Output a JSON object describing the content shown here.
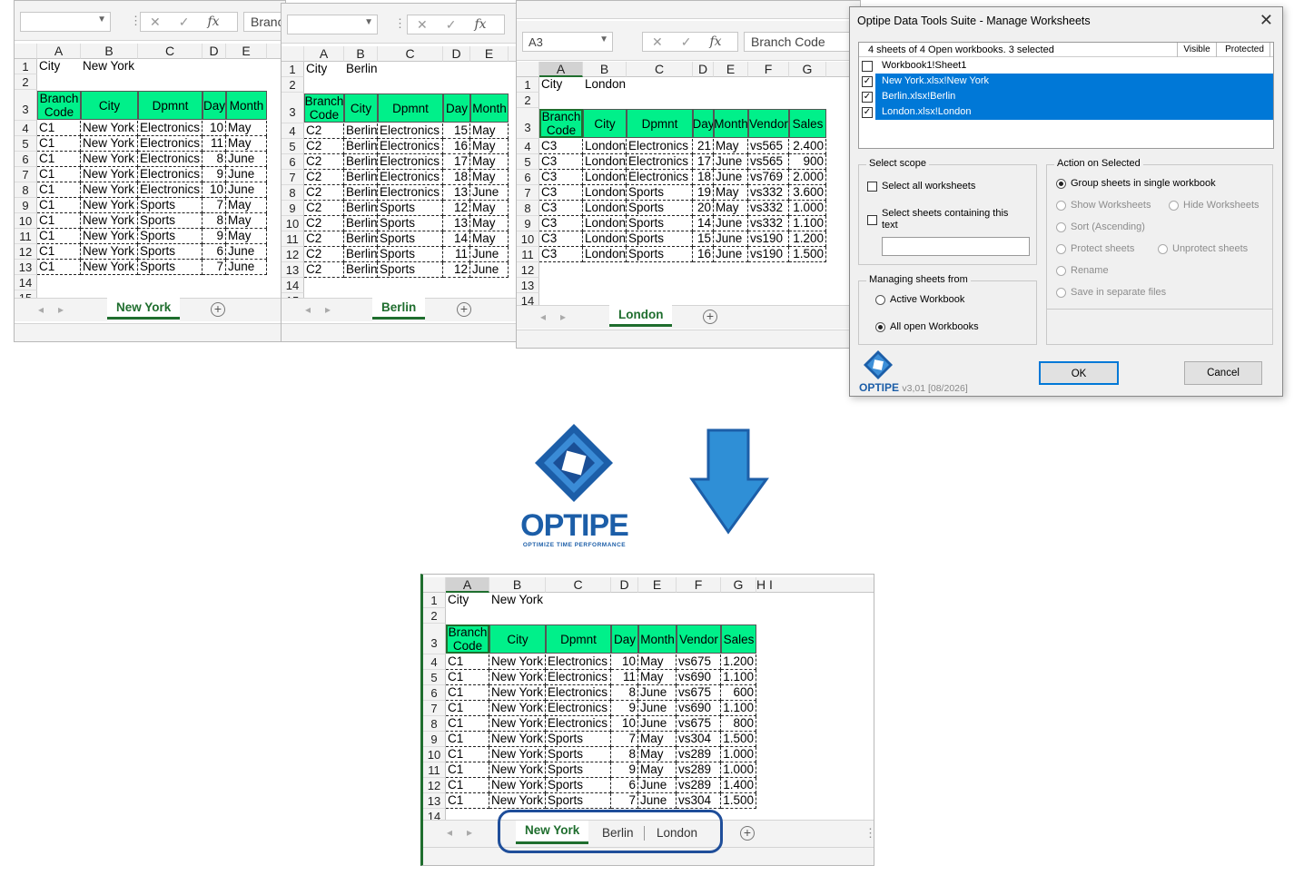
{
  "cols_short": [
    "A",
    "B",
    "C",
    "D",
    "E"
  ],
  "cols_full": [
    "A",
    "B",
    "C",
    "D",
    "E",
    "F",
    "G"
  ],
  "cols_bottom": [
    "A",
    "B",
    "C",
    "D",
    "E",
    "F",
    "G",
    "H",
    "I"
  ],
  "rows_label": [
    "1",
    "2",
    "3",
    "4",
    "5",
    "6",
    "7",
    "8",
    "9",
    "10",
    "11",
    "12",
    "13",
    "14",
    "15"
  ],
  "headers": [
    "Branch Code",
    "City",
    "Dpmnt",
    "Day",
    "Month",
    "Vendor",
    "Sales"
  ],
  "ny": {
    "namebox": "",
    "formula": "Branch Code",
    "city_label": "City",
    "city_value": "New York",
    "tab": "New York",
    "rows": [
      [
        "C1",
        "New York",
        "Electronics",
        "10",
        "May",
        "vs675",
        "1.200"
      ],
      [
        "C1",
        "New York",
        "Electronics",
        "11",
        "May",
        "vs690",
        "1.100"
      ],
      [
        "C1",
        "New York",
        "Electronics",
        "8",
        "June",
        "vs675",
        "600"
      ],
      [
        "C1",
        "New York",
        "Electronics",
        "9",
        "June",
        "vs690",
        "1.100"
      ],
      [
        "C1",
        "New York",
        "Electronics",
        "10",
        "June",
        "vs675",
        "800"
      ],
      [
        "C1",
        "New York",
        "Sports",
        "7",
        "May",
        "vs304",
        "1.500"
      ],
      [
        "C1",
        "New York",
        "Sports",
        "8",
        "May",
        "vs289",
        "1.000"
      ],
      [
        "C1",
        "New York",
        "Sports",
        "9",
        "May",
        "vs289",
        "1.000"
      ],
      [
        "C1",
        "New York",
        "Sports",
        "6",
        "June",
        "vs289",
        "1.400"
      ],
      [
        "C1",
        "New York",
        "Sports",
        "7",
        "June",
        "vs304",
        "1.500"
      ]
    ]
  },
  "berlin": {
    "namebox": "",
    "formula": "Branch Code",
    "city_label": "City",
    "city_value": "Berlin",
    "tab": "Berlin",
    "rows": [
      [
        "C2",
        "Berlin",
        "Electronics",
        "15",
        "May"
      ],
      [
        "C2",
        "Berlin",
        "Electronics",
        "16",
        "May"
      ],
      [
        "C2",
        "Berlin",
        "Electronics",
        "17",
        "May"
      ],
      [
        "C2",
        "Berlin",
        "Electronics",
        "18",
        "May"
      ],
      [
        "C2",
        "Berlin",
        "Electronics",
        "13",
        "June"
      ],
      [
        "C2",
        "Berlin",
        "Sports",
        "12",
        "May"
      ],
      [
        "C2",
        "Berlin",
        "Sports",
        "13",
        "May"
      ],
      [
        "C2",
        "Berlin",
        "Sports",
        "14",
        "May"
      ],
      [
        "C2",
        "Berlin",
        "Sports",
        "11",
        "June"
      ],
      [
        "C2",
        "Berlin",
        "Sports",
        "12",
        "June"
      ]
    ]
  },
  "london": {
    "namebox": "A3",
    "formula": "Branch Code",
    "city_label": "City",
    "city_value": "London",
    "tab": "London",
    "rows": [
      [
        "C3",
        "London",
        "Electronics",
        "21",
        "May",
        "vs565",
        "2.400"
      ],
      [
        "C3",
        "London",
        "Electronics",
        "17",
        "June",
        "vs565",
        "900"
      ],
      [
        "C3",
        "London",
        "Electronics",
        "18",
        "June",
        "vs769",
        "2.000"
      ],
      [
        "C3",
        "London",
        "Sports",
        "19",
        "May",
        "vs332",
        "3.600"
      ],
      [
        "C3",
        "London",
        "Sports",
        "20",
        "May",
        "vs332",
        "1.000"
      ],
      [
        "C3",
        "London",
        "Sports",
        "14",
        "June",
        "vs332",
        "1.100"
      ],
      [
        "C3",
        "London",
        "Sports",
        "15",
        "June",
        "vs190",
        "1.200"
      ],
      [
        "C3",
        "London",
        "Sports",
        "16",
        "June",
        "vs190",
        "1.500"
      ]
    ]
  },
  "result": {
    "tabs": [
      "New York",
      "Berlin",
      "London"
    ],
    "highlight_color": "#1f4e9a"
  },
  "dialog": {
    "title": "Optipe Data Tools Suite - Manage Worksheets",
    "list_header": "4 sheets of 4 Open workbooks.  3 selected",
    "col_visible": "Visible",
    "col_protected": "Protected",
    "items": [
      {
        "label": "Workbook1!Sheet1",
        "checked": false
      },
      {
        "label": "New York.xlsx!New York",
        "checked": true
      },
      {
        "label": "Berlin.xlsx!Berlin",
        "checked": true
      },
      {
        "label": "London.xlsx!London",
        "checked": true
      }
    ],
    "scope_title": "Select scope",
    "select_all": "Select all worksheets",
    "select_containing": "Select sheets containing this text",
    "containing_value": "",
    "action_title": "Action on Selected",
    "actions": {
      "group": "Group sheets in single workbook",
      "show": "Show Worksheets",
      "hide": "Hide Worksheets",
      "sort": "Sort (Ascending)",
      "protect": "Protect sheets",
      "unprotect": "Unprotect sheets",
      "rename": "Rename",
      "save": "Save in separate files"
    },
    "managing_title": "Managing sheets from",
    "active_wb": "Active Workbook",
    "all_wb": "All open Workbooks",
    "ok": "OK",
    "cancel": "Cancel",
    "brand": "OPTIPE",
    "version": "v3,01 [08/2026]"
  },
  "logo": {
    "name": "OPTIPE",
    "tagline": "OPTIMIZE TIME PERFORMANCE"
  },
  "colors": {
    "header_green": "#00f08a",
    "tab_green": "#1f6e2e",
    "selection_blue": "#0078d7",
    "arrow_blue": "#2f8fd6"
  }
}
